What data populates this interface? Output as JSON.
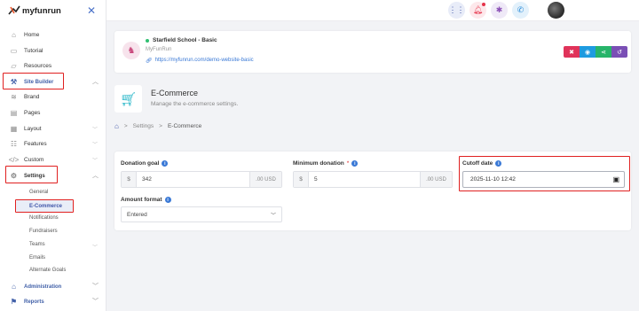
{
  "app": {
    "brand": "myfunrun"
  },
  "colors": {
    "accent": "#3f56a8",
    "highlight": "#e02020",
    "link": "#3a79d6"
  },
  "sidebar": {
    "items": [
      {
        "label": "Home",
        "icon": "home-icon"
      },
      {
        "label": "Tutorial",
        "icon": "book-icon"
      },
      {
        "label": "Resources",
        "icon": "folder-icon"
      },
      {
        "label": "Site Builder",
        "icon": "hammer-icon"
      },
      {
        "label": "Brand",
        "icon": "layers-icon"
      },
      {
        "label": "Pages",
        "icon": "pages-icon"
      },
      {
        "label": "Layout",
        "icon": "layout-icon"
      },
      {
        "label": "Features",
        "icon": "features-icon"
      },
      {
        "label": "Custom",
        "icon": "code-icon"
      },
      {
        "label": "Settings",
        "icon": "gear-icon"
      },
      {
        "label": "Administration",
        "icon": "bank-icon"
      },
      {
        "label": "Reports",
        "icon": "reports-icon"
      }
    ],
    "settings_sub": [
      "General",
      "E-Commerce",
      "Notifications",
      "Fundraisers",
      "Teams",
      "Emails",
      "Alternate Goals"
    ]
  },
  "site": {
    "name": "Starfield School - Basic",
    "org": "MyFunRun",
    "url": "https://myfunrun.com/demo-website-basic"
  },
  "page": {
    "title": "E-Commerce",
    "subtitle": "Manage the e-commerce settings.",
    "breadcrumb": [
      "Settings",
      "E-Commerce"
    ]
  },
  "form": {
    "donation_goal": {
      "label": "Donation goal",
      "prefix": "$",
      "value": "342",
      "suffix": ".00 USD"
    },
    "min_donation": {
      "label": "Minimum donation",
      "required_mark": "*",
      "prefix": "$",
      "value": "5",
      "suffix": ".00 USD"
    },
    "cutoff_date": {
      "label": "Cutoff date",
      "value": "2025-11-10 12:42"
    },
    "amount_format": {
      "label": "Amount format",
      "value": "Entered"
    }
  }
}
